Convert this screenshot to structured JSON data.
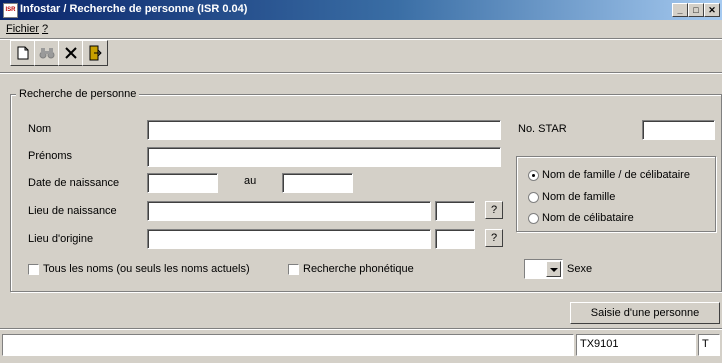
{
  "window": {
    "title": "Infostar / Recherche de personne (ISR 0.04)",
    "app_icon_text": "ISR"
  },
  "menu": {
    "items": [
      "Fichier",
      "?"
    ]
  },
  "toolbar": {
    "buttons": [
      "new-document-icon",
      "binoculars-icon",
      "delete-x-icon",
      "exit-door-icon"
    ]
  },
  "group": {
    "title": "Recherche de personne",
    "labels": {
      "nom": "Nom",
      "prenoms": "Prénoms",
      "date_naissance": "Date de naissance",
      "au": "au",
      "lieu_naissance": "Lieu de naissance",
      "lieu_origine": "Lieu d'origine",
      "no_star": "No. STAR",
      "sexe": "Sexe"
    },
    "values": {
      "nom": "",
      "prenoms": "",
      "date_from": "",
      "date_to": "",
      "lieu_naissance": "",
      "lieu_naissance_code": "",
      "lieu_origine": "",
      "lieu_origine_code": "",
      "no_star": "",
      "sexe": ""
    },
    "lookup_button": "?",
    "checkboxes": [
      {
        "label": "Tous les noms (ou seuls les noms actuels)",
        "checked": false
      },
      {
        "label": "Recherche phonétique",
        "checked": false
      }
    ],
    "radios": [
      {
        "label": "Nom de famille / de célibataire",
        "selected": true
      },
      {
        "label": "Nom de famille",
        "selected": false
      },
      {
        "label": "Nom de célibataire",
        "selected": false
      }
    ]
  },
  "actions": {
    "saisie": "Saisie d'une personne"
  },
  "status": {
    "cells": [
      "",
      "TX9101",
      "T"
    ]
  }
}
